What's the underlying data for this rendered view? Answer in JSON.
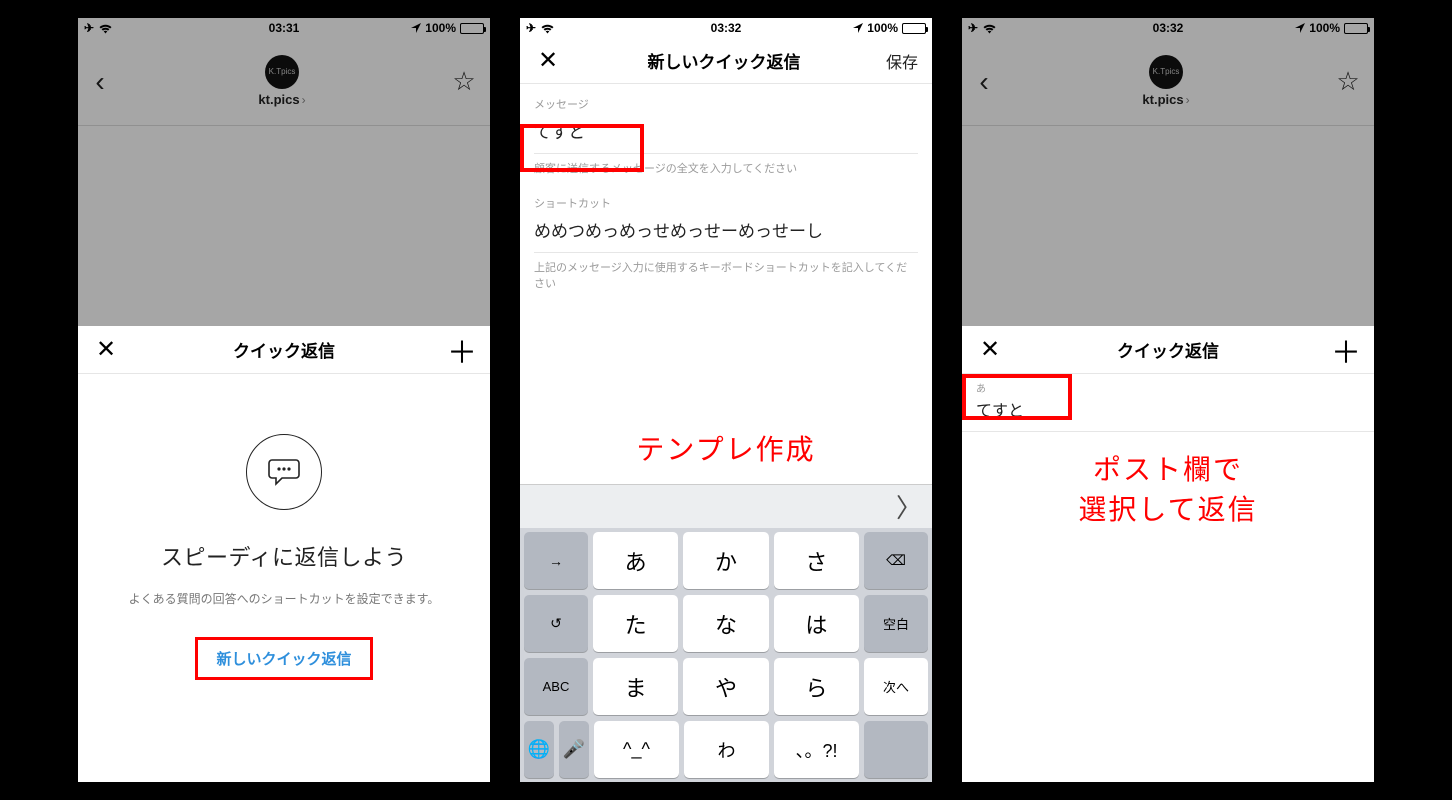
{
  "status_left_battery_pct": "100%",
  "phone1": {
    "time": "03:31",
    "chat_user": "kt.pics",
    "avatar_text": "K.Tpics",
    "sheet_title": "クイック返信",
    "headline": "スピーディに返信しよう",
    "subtext": "よくある質問の回答へのショートカットを設定できます。",
    "cta": "新しいクイック返信"
  },
  "phone2": {
    "time": "03:32",
    "nav_title": "新しいクイック返信",
    "save_label": "保存",
    "msg_label": "メッセージ",
    "msg_value": "てすと",
    "msg_help": "顧客に送信するメッセージの全文を入力してください",
    "sc_label": "ショートカット",
    "sc_value": "めめつめっめっせめっせーめっせーし",
    "sc_help": "上記のメッセージ入力に使用するキーボードショートカットを記入してください",
    "caption": "テンプレ作成",
    "keyboard": {
      "row1": [
        "→",
        "あ",
        "か",
        "さ",
        "⌫"
      ],
      "row2": [
        "↺",
        "た",
        "な",
        "は",
        "空白"
      ],
      "row3": [
        "ABC",
        "ま",
        "や",
        "ら",
        "次へ"
      ],
      "row4": [
        "🌐",
        "🎤",
        "^_^",
        "わ",
        "、。?!",
        ""
      ]
    }
  },
  "phone3": {
    "time": "03:32",
    "chat_user": "kt.pics",
    "avatar_text": "K.Tpics",
    "sheet_title": "クイック返信",
    "item_cap": "あ",
    "item_val": "てすと",
    "caption_line1": "ポスト欄で",
    "caption_line2": "選択して返信"
  }
}
